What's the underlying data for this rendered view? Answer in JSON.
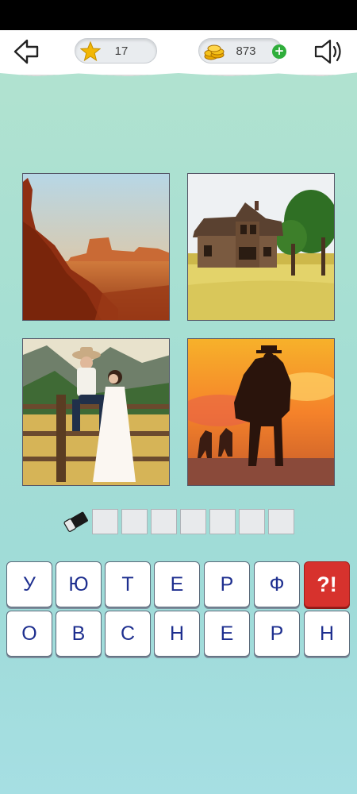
{
  "header": {
    "stars": "17",
    "coins": "873",
    "icons": {
      "back": "back-arrow-icon",
      "star": "star-icon",
      "coins": "coins-icon",
      "add_coins": "plus-icon",
      "sound": "speaker-icon"
    }
  },
  "puzzle": {
    "images": [
      {
        "name": "desert-canyon-picture"
      },
      {
        "name": "old-farmhouse-picture"
      },
      {
        "name": "cowboy-couple-fence-picture"
      },
      {
        "name": "horse-rider-sunset-picture"
      }
    ],
    "answer_slots": [
      "",
      "",
      "",
      "",
      "",
      "",
      ""
    ]
  },
  "keyboard": {
    "row1": [
      "У",
      "Ю",
      "Т",
      "Е",
      "Р",
      "Ф"
    ],
    "hint_label": "?!",
    "row2": [
      "О",
      "В",
      "С",
      "Н",
      "Е",
      "Р",
      "Н"
    ]
  },
  "colors": {
    "hint_button": "#d7322d",
    "letter_text": "#1e2f8f",
    "coin_plus": "#2fae3b"
  }
}
